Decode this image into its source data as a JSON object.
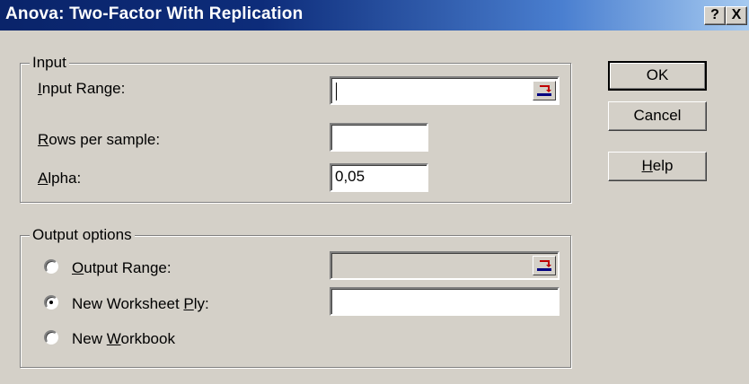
{
  "window": {
    "title": "Anova: Two-Factor With Replication",
    "help_button": "?",
    "close_button": "X"
  },
  "input_group": {
    "legend": "Input",
    "input_range_label": {
      "accel": "I",
      "rest": "nput Range:"
    },
    "input_range_value": "",
    "rows_label": {
      "accel": "R",
      "rest": "ows per sample:"
    },
    "rows_value": "",
    "alpha_label": {
      "accel": "A",
      "rest": "lpha:"
    },
    "alpha_value": "0,05"
  },
  "output_group": {
    "legend": "Output options",
    "output_range": {
      "accel": "O",
      "rest": "utput Range:",
      "selected": false,
      "value": ""
    },
    "new_worksheet": {
      "pre": "New Worksheet ",
      "accel": "P",
      "rest": "ly:",
      "selected": true,
      "value": ""
    },
    "new_workbook": {
      "pre": "New ",
      "accel": "W",
      "rest": "orkbook",
      "selected": false
    }
  },
  "buttons": {
    "ok": "OK",
    "cancel": "Cancel",
    "help": {
      "accel": "H",
      "rest": "elp"
    }
  }
}
